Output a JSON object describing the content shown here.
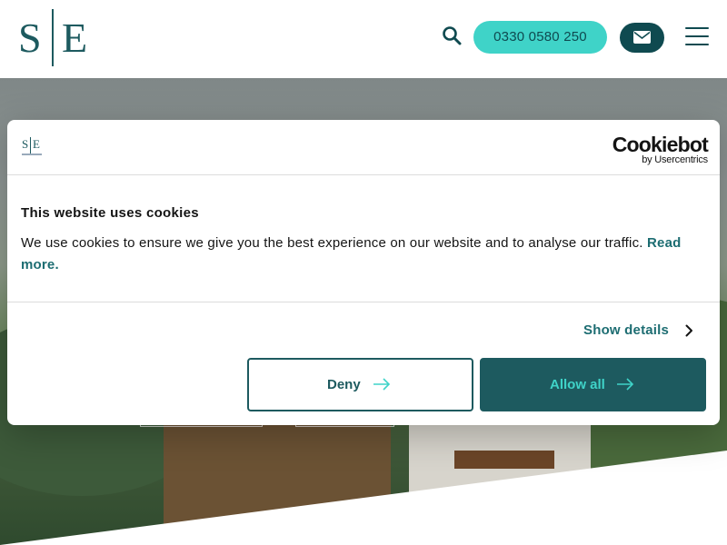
{
  "header": {
    "logo_left": "S",
    "logo_right": "E",
    "phone": "0330 0580 250",
    "icons": [
      "search-icon",
      "mail-icon",
      "hamburger-menu-icon"
    ]
  },
  "cookie": {
    "brand_name": "Cookiebot",
    "brand_by": "by Usercentrics",
    "title": "This website uses cookies",
    "body": "We use cookies to ensure we give you the best experience on our website and to analyse our traffic.",
    "read_more": "Read more.",
    "show_details": "Show details",
    "deny": "Deny",
    "allow_all": "Allow all"
  },
  "colors": {
    "brand_teal": "#1d5a5f",
    "accent_aqua": "#3fd3c8",
    "dark_teal": "#0f4a50"
  }
}
